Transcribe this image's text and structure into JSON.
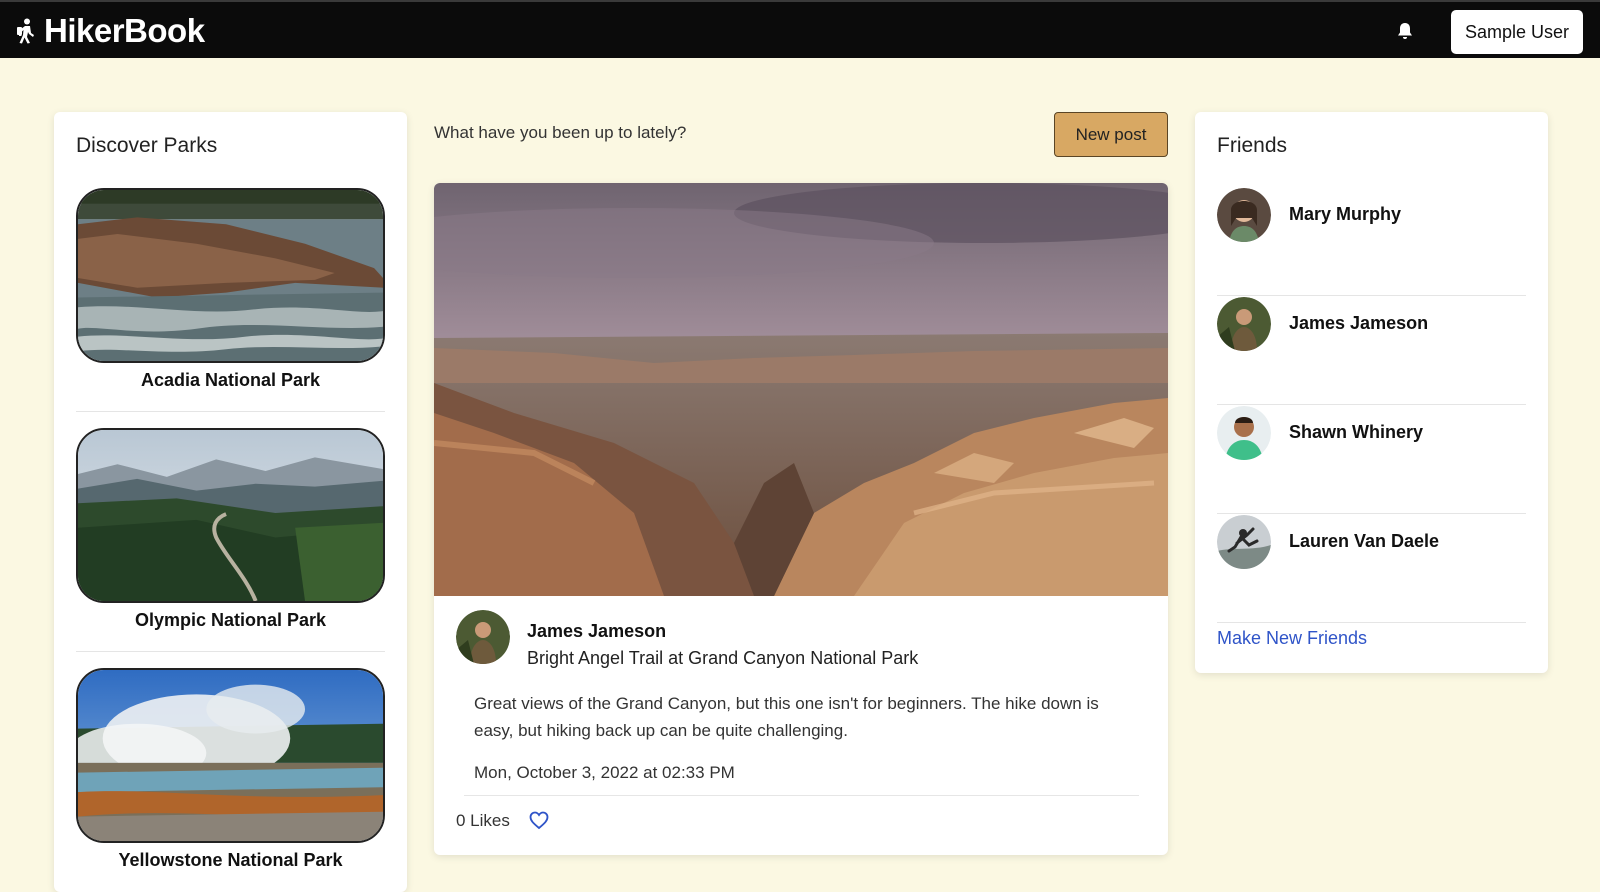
{
  "navbar": {
    "brand": "HikerBook",
    "user_button": "Sample User"
  },
  "icons": {
    "brand": "hiker-icon",
    "notifications": "bell-icon",
    "like": "heart-icon"
  },
  "colors": {
    "navbar_bg": "#0b0b0b",
    "page_bg": "#fbf8e2",
    "new_post_bg": "#d8a863",
    "link": "#2f54c8"
  },
  "parks": {
    "title": "Discover Parks",
    "items": [
      {
        "name": "Acadia National Park"
      },
      {
        "name": "Olympic National Park"
      },
      {
        "name": "Yellowstone National Park"
      }
    ]
  },
  "feed": {
    "prompt": "What have you been up to lately?",
    "new_post_label": "New post",
    "post": {
      "author": "James Jameson",
      "trail": "Bright Angel Trail",
      "at_word": "at",
      "park": "Grand Canyon National Park",
      "body": "Great views of the Grand Canyon, but this one isn't for beginners. The hike down is easy, but hiking back up can be quite challenging.",
      "date": "Mon, October 3, 2022 at 02:33 PM",
      "likes": "0 Likes"
    }
  },
  "friends": {
    "title": "Friends",
    "items": [
      {
        "name": "Mary Murphy"
      },
      {
        "name": "James Jameson"
      },
      {
        "name": "Shawn Whinery"
      },
      {
        "name": "Lauren Van Daele"
      }
    ],
    "make_new_label": "Make New Friends"
  }
}
